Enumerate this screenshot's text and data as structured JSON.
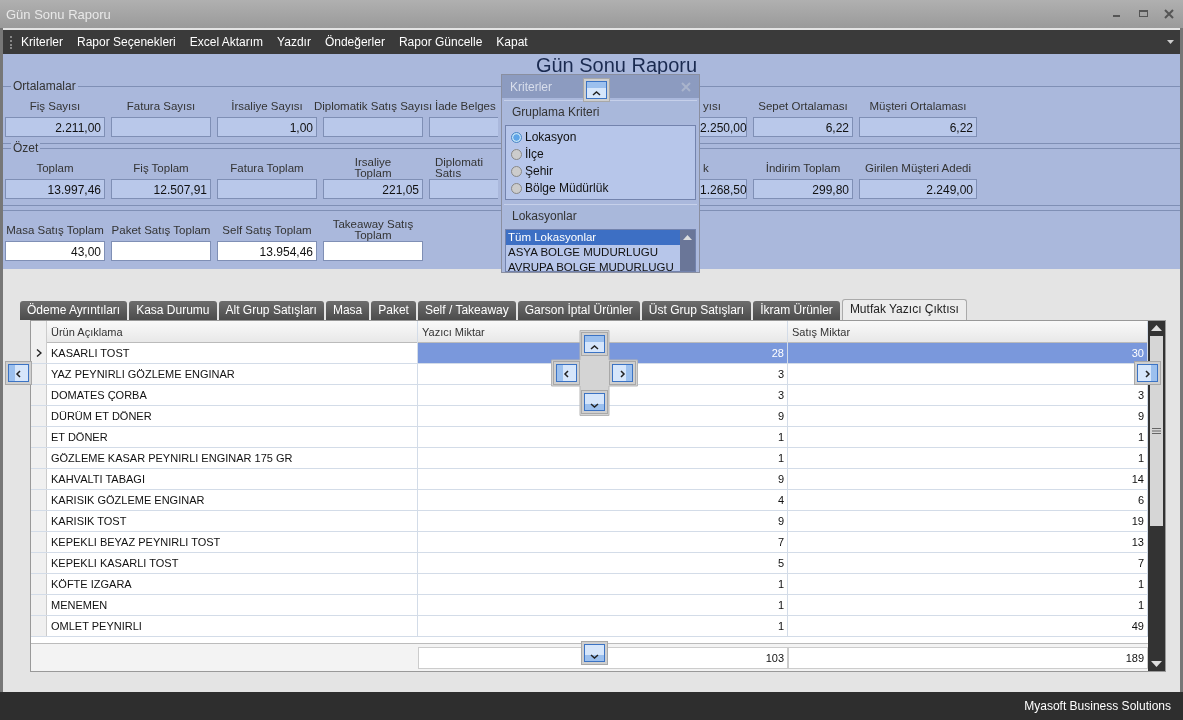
{
  "window": {
    "title": "Gün Sonu Raporu"
  },
  "menu": [
    "Kriterler",
    "Rapor Seçenekleri",
    "Excel Aktarım",
    "Yazdır",
    "Öndeğerler",
    "Rapor Güncelle",
    "Kapat"
  ],
  "report_title": "Gün Sonu Raporu",
  "groups": [
    {
      "title": "Ortalamalar",
      "fields": [
        {
          "kind": "full",
          "label": "Fiş Sayısı",
          "value": "2.211,00"
        },
        {
          "kind": "full",
          "label": "Fatura Sayısı"
        },
        {
          "kind": "full",
          "label": "İrsaliye Sayısı",
          "value": "1,00"
        },
        {
          "kind": "full",
          "label": "Diplomatik Satış Sayısı"
        },
        {
          "kind": "cut_right",
          "label": "İade Belges"
        },
        {
          "kind": "cut_left",
          "label": "yısı",
          "value": "2.250,00"
        },
        {
          "kind": "full",
          "label": "Sepet Ortalaması",
          "value": "6,22"
        },
        {
          "kind": "wide",
          "label": "Müşteri Ortalaması",
          "value": "6,22"
        }
      ]
    },
    {
      "title": "Özet",
      "fields": [
        {
          "kind": "full",
          "label": "Toplam",
          "value": "13.997,46"
        },
        {
          "kind": "full",
          "label": "Fiş Toplam",
          "value": "12.507,91"
        },
        {
          "kind": "full",
          "label": "Fatura Toplam"
        },
        {
          "kind": "full",
          "label": "Irsaliye\nToplam",
          "value": "221,05"
        },
        {
          "kind": "cut_right",
          "label": "Diplomati\nSatıs"
        },
        {
          "kind": "cut_left",
          "label": "k",
          "value": "1.268,50"
        },
        {
          "kind": "full",
          "label": "İndirim Toplam",
          "value": "299,80"
        },
        {
          "kind": "wide",
          "label": "Girilen Müşteri Adedi",
          "value": "2.249,00"
        }
      ]
    },
    {
      "fields": [
        {
          "kind": "full",
          "label": "Masa Satış Toplam",
          "value": "43,00"
        },
        {
          "kind": "full",
          "label": "Paket Satış Toplam"
        },
        {
          "kind": "full",
          "label": "Self Satış Toplam",
          "value": "13.954,46"
        },
        {
          "kind": "full",
          "label": "Takeaway Satış\nToplam"
        }
      ]
    }
  ],
  "dialog": {
    "title": "Kriterler",
    "grouping": {
      "title": "Gruplama Kriteri",
      "options": [
        {
          "label": "Lokasyon",
          "selected": true
        },
        {
          "label": "İlçe",
          "selected": false
        },
        {
          "label": "Şehir",
          "selected": false
        },
        {
          "label": "Bölge Müdürlük",
          "selected": false
        }
      ]
    },
    "locations": {
      "title": "Lokasyonlar",
      "items": [
        {
          "label": "Tüm Lokasyonlar",
          "selected": true
        },
        {
          "label": "ASYA BOLGE MUDURLUGU",
          "selected": false
        },
        {
          "label": "AVRUPA BOLGE MUDURLUGU",
          "selected": false
        }
      ]
    }
  },
  "tabs": [
    {
      "label": "Ödeme Ayrıntıları",
      "selected": false
    },
    {
      "label": "Kasa Durumu",
      "selected": false
    },
    {
      "label": "Alt Grup Satışları",
      "selected": false
    },
    {
      "label": "Masa",
      "selected": false
    },
    {
      "label": "Paket",
      "selected": false
    },
    {
      "label": "Self / Takeaway",
      "selected": false
    },
    {
      "label": "Garson İptal Ürünler",
      "selected": false
    },
    {
      "label": "Üst Grup Satışları",
      "selected": false
    },
    {
      "label": "İkram Ürünler",
      "selected": false
    },
    {
      "label": "Mutfak Yazıcı Çıktısı",
      "selected": true
    }
  ],
  "table": {
    "columns": [
      "Ürün Açıklama",
      "Yazıcı Miktar",
      "Satış Miktar"
    ],
    "rows": [
      {
        "selected": true,
        "cells": [
          "KASARLI TOST",
          "28",
          "30"
        ]
      },
      {
        "selected": false,
        "cells": [
          "YAZ PEYNIRLI GÖZLEME ENGINAR",
          "3",
          null
        ]
      },
      {
        "selected": false,
        "cells": [
          "DOMATES ÇORBA",
          "3",
          "3"
        ]
      },
      {
        "selected": false,
        "cells": [
          "DÜRÜM ET DÖNER",
          "9",
          "9"
        ]
      },
      {
        "selected": false,
        "cells": [
          "ET DÖNER",
          "1",
          "1"
        ]
      },
      {
        "selected": false,
        "cells": [
          "GÖZLEME KASAR PEYNIRLI ENGINAR  175 GR",
          "1",
          "1"
        ]
      },
      {
        "selected": false,
        "cells": [
          "KAHVALTI TABAGI",
          "9",
          "14"
        ]
      },
      {
        "selected": false,
        "cells": [
          "KARISIK GÖZLEME ENGINAR",
          "4",
          "6"
        ]
      },
      {
        "selected": false,
        "cells": [
          "KARISIK TOST",
          "9",
          "19"
        ]
      },
      {
        "selected": false,
        "cells": [
          "KEPEKLI BEYAZ PEYNIRLI TOST",
          "7",
          "13"
        ]
      },
      {
        "selected": false,
        "cells": [
          "KEPEKLI KASARLI TOST",
          "5",
          "7"
        ]
      },
      {
        "selected": false,
        "cells": [
          "KÖFTE IZGARA",
          "1",
          "1"
        ]
      },
      {
        "selected": false,
        "cells": [
          "MENEMEN",
          "1",
          "1"
        ]
      },
      {
        "selected": false,
        "cells": [
          "OMLET PEYNIRLI",
          "1",
          "49"
        ]
      }
    ],
    "totals": [
      "103",
      "189"
    ]
  },
  "status_bar": "Myasoft Business Solutions"
}
